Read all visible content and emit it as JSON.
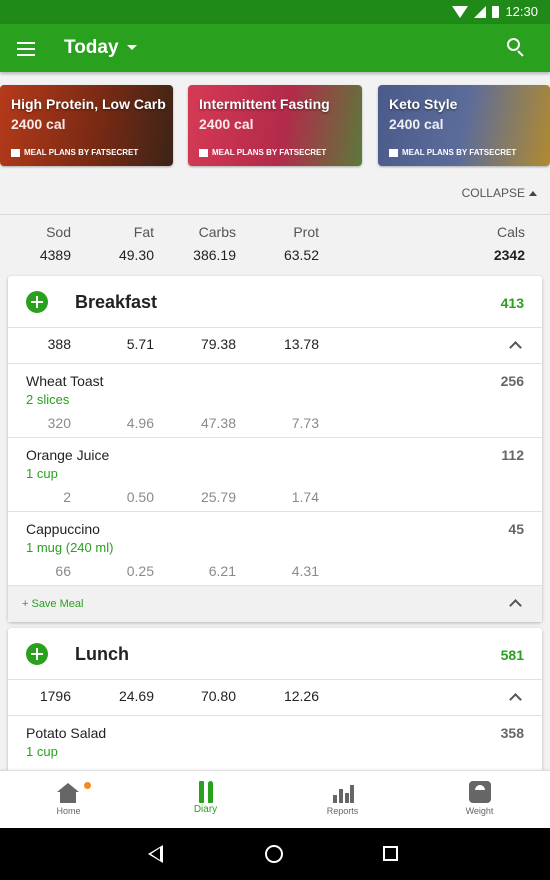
{
  "status_bar": {
    "time": "12:30"
  },
  "app_bar": {
    "title": "Today"
  },
  "banners": [
    {
      "title": "High Protein, Low Carb",
      "calories": "2400 cal",
      "footer": "MEAL PLANS BY FATSECRET"
    },
    {
      "title": "Intermittent Fasting",
      "calories": "2400 cal",
      "footer": "MEAL PLANS BY FATSECRET"
    },
    {
      "title": "Keto Style",
      "calories": "2400 cal",
      "footer": "MEAL PLANS BY FATSECRET"
    }
  ],
  "collapse_label": "COLLAPSE",
  "totals": {
    "headers": {
      "sod": "Sod",
      "fat": "Fat",
      "carbs": "Carbs",
      "prot": "Prot",
      "cals": "Cals"
    },
    "values": {
      "sod": "4389",
      "fat": "49.30",
      "carbs": "386.19",
      "prot": "63.52",
      "cals": "2342"
    }
  },
  "meals": [
    {
      "name": "Breakfast",
      "calories": "413",
      "summary": {
        "sod": "388",
        "fat": "5.71",
        "carbs": "79.38",
        "prot": "13.78"
      },
      "items": [
        {
          "name": "Wheat Toast",
          "portion": "2 slices",
          "calories": "256",
          "sod": "320",
          "fat": "4.96",
          "carbs": "47.38",
          "prot": "7.73"
        },
        {
          "name": "Orange Juice",
          "portion": "1 cup",
          "calories": "112",
          "sod": "2",
          "fat": "0.50",
          "carbs": "25.79",
          "prot": "1.74"
        },
        {
          "name": "Cappuccino",
          "portion": "1 mug (240 ml)",
          "calories": "45",
          "sod": "66",
          "fat": "0.25",
          "carbs": "6.21",
          "prot": "4.31"
        }
      ],
      "save_label": "+ Save Meal"
    },
    {
      "name": "Lunch",
      "calories": "581",
      "summary": {
        "sod": "1796",
        "fat": "24.69",
        "carbs": "70.80",
        "prot": "12.26"
      },
      "items": [
        {
          "name": "Potato Salad",
          "portion": "1 cup",
          "calories": "358"
        }
      ]
    }
  ],
  "bottom_nav": [
    {
      "label": "Home",
      "icon": "home-icon"
    },
    {
      "label": "Diary",
      "icon": "diary-icon",
      "active": true
    },
    {
      "label": "Reports",
      "icon": "reports-icon"
    },
    {
      "label": "Weight",
      "icon": "weight-icon"
    }
  ],
  "colors": {
    "primary": "#2aa01f",
    "status_bar": "#1f8a17",
    "notification_dot": "#f08a24"
  }
}
